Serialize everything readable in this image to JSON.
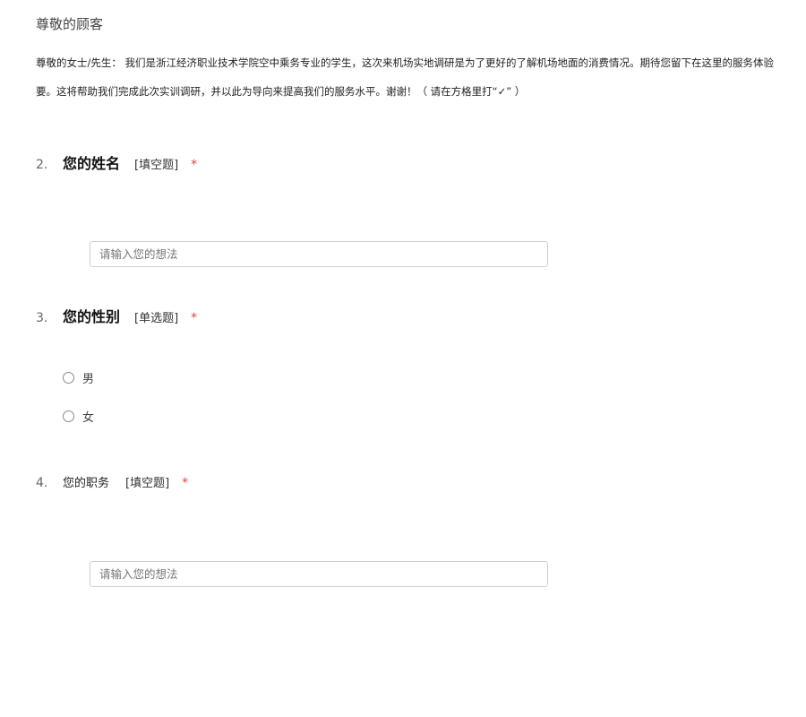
{
  "survey": {
    "title": "尊敬的顾客",
    "intro_line1": "尊敬的女士/先生： 我们是浙江经济职业技术学院空中乘务专业的学生，这次来机场实地调研是为了更好的了解机场地面的消费情况。期待您留下在这里的服务体验",
    "intro_line2": "要。这将帮助我们完成此次实训调研，并以此为导向来提高我们的服务水平。谢谢！（ 请在方格里打“✓” ）"
  },
  "questions": [
    {
      "number": "2.",
      "title": "您的姓名",
      "type": "[填空题]",
      "required_mark": "*",
      "placeholder": "请输入您的想法"
    },
    {
      "number": "3.",
      "title": "您的性别",
      "type": "[单选题]",
      "required_mark": "*",
      "options": [
        "男",
        "女"
      ]
    },
    {
      "number": "4.",
      "title": "您的职务",
      "type": "[填空题]",
      "required_mark": "*",
      "placeholder": "请输入您的想法"
    }
  ],
  "colors": {
    "required": "#e84040",
    "input_border": "#cfcfcf",
    "text": "#333333"
  }
}
